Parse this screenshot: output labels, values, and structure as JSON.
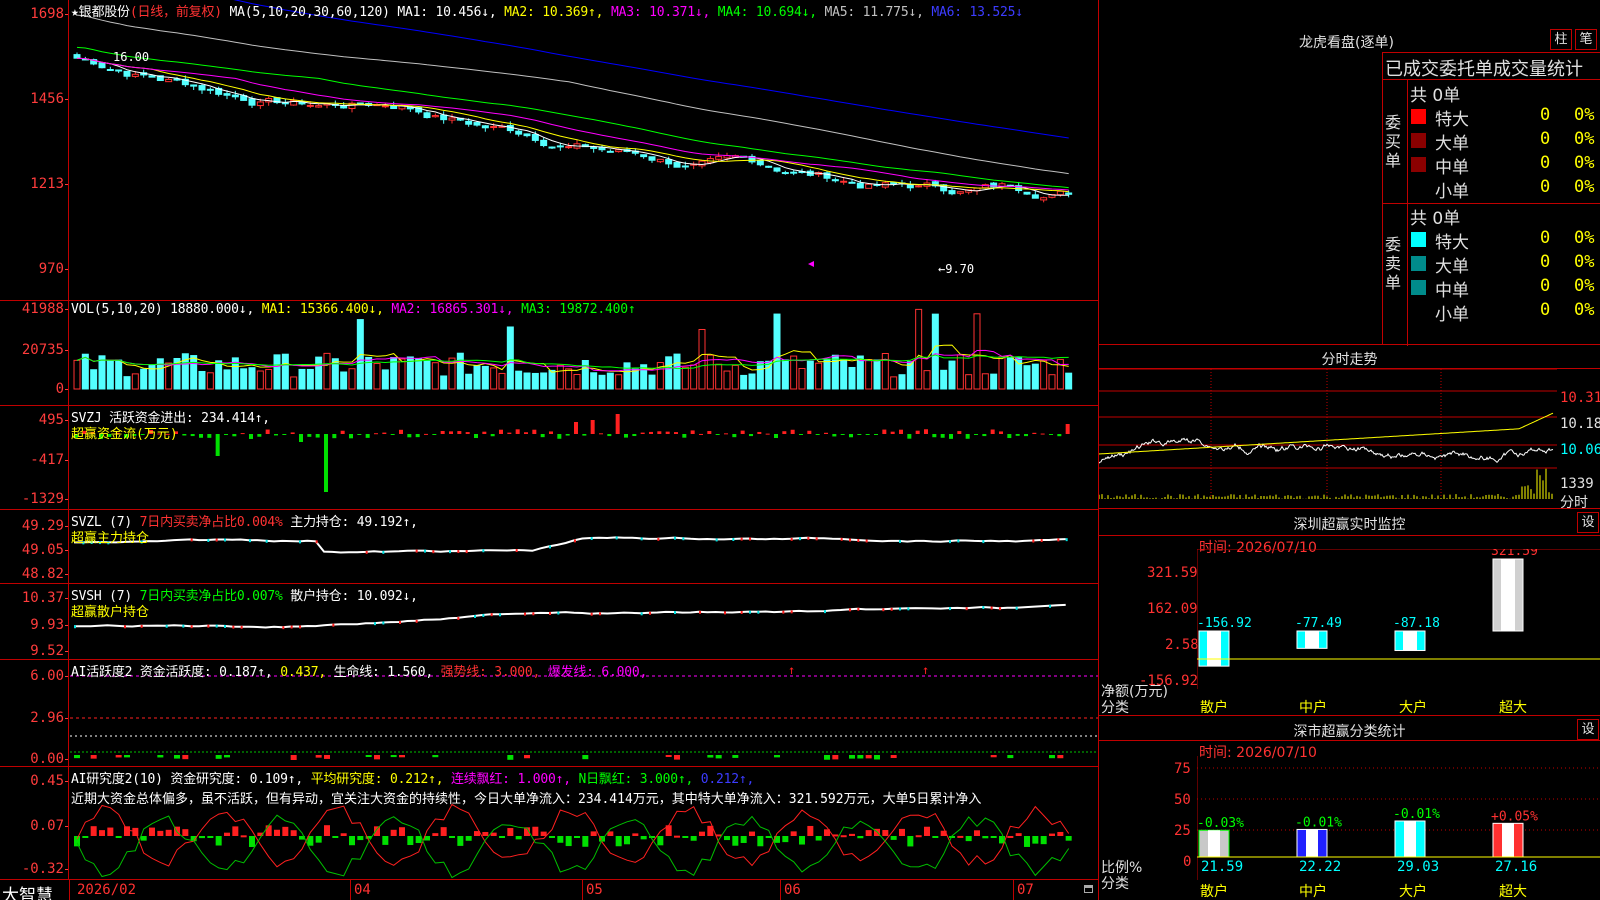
{
  "kline": {
    "star": "★",
    "stock_name": "银都股份",
    "period": "(日线，前复权)",
    "ma_params": "MA(5,10,20,30,60,120)",
    "ma1": "MA1: 10.456↓,",
    "ma2": "MA2: 10.369↑,",
    "ma3": "MA3: 10.371↓,",
    "ma4": "MA4: 10.694↓,",
    "ma5": "MA5: 11.775↓,",
    "ma6": "MA6: 13.525↓",
    "y_ticks": [
      "1698",
      "1456",
      "1213",
      "970"
    ],
    "high_label": "16.00",
    "low_label": "←9.70",
    "colors": {
      "ma1": "#ffffff",
      "ma2": "#ffff00",
      "ma3": "#ff00ff",
      "ma4": "#00ff00",
      "ma5": "#c0c0c0",
      "ma6": "#0000ff",
      "up": "#ff3232",
      "down": "#54ffff"
    }
  },
  "vol": {
    "title": "VOL(5,10,20)",
    "value": "18880.000↓,",
    "ma1": "MA1: 15366.400↓,",
    "ma2": "MA2: 16865.301↓,",
    "ma3": "MA3: 19872.400↑",
    "y_ticks": [
      "41988",
      "20735",
      "0"
    ]
  },
  "svzj": {
    "title": "SVZJ  活跃资金进出: 234.414↑,",
    "subtitle": "超赢资金流(万元)",
    "y_ticks": [
      "495",
      "-417",
      "-1329"
    ]
  },
  "svzl": {
    "title": "SVZL (7)",
    "net": "7日内买卖净占比0.004%",
    "hold": "主力持仓: 49.192↑,",
    "subtitle": "超赢主力持仓",
    "y_ticks": [
      "49.29",
      "49.05",
      "48.82"
    ]
  },
  "svsh": {
    "title": "SVSH (7)",
    "net": "7日内买卖净占比0.007%",
    "hold": "散户持仓: 10.092↓,",
    "subtitle": "超赢散户持仓",
    "y_ticks": [
      "10.37",
      "9.93",
      "9.52"
    ]
  },
  "ai_active": {
    "title": "AI活跃度2 资金活跃度: 0.187↑,",
    "v2": "0.437,",
    "life": "生命线: 1.560,",
    "strong": "强势线: 3.000,",
    "burst": "爆发线: 6.000,",
    "y_ticks": [
      "6.00",
      "2.96",
      "0.00"
    ]
  },
  "ai_research": {
    "title": "AI研究度2(10) 资金研究度: 0.109↑,",
    "avg": "平均研究度: 0.212↑,",
    "cont": "连续飘红: 1.000↑,",
    "nday": "N日飘红: 3.000↑,",
    "last": "0.212↑,",
    "comment": "近期大资金总体偏多，虽不活跃，但有异动，宜关注大资金的持续性，今日大单净流入：234.414万元，其中特大单净流入：321.592万元，大单5日累计净入",
    "y_ticks": [
      "0.45",
      "0.07",
      "-0.32"
    ]
  },
  "xaxis": {
    "brand": "大智慧",
    "labels": [
      "2026/02",
      "04",
      "05",
      "06",
      "07"
    ]
  },
  "lhb": {
    "title": "龙虎看盘(逐单)",
    "btn_bar": "柱",
    "btn_pen": "笔",
    "table_title": "已成交委托单成交量统计",
    "buy_side": "委买单",
    "sell_side": "委卖单",
    "buy_total": "共 0单",
    "sell_total": "共 0单",
    "rows": [
      {
        "label": "特大",
        "count": "0",
        "pct": "0%"
      },
      {
        "label": "大单",
        "count": "0",
        "pct": "0%"
      },
      {
        "label": "中单",
        "count": "0",
        "pct": "0%"
      },
      {
        "label": "小单",
        "count": "0",
        "pct": "0%"
      }
    ],
    "buy_colors": [
      "#ff0000",
      "#8b0000",
      "#8b0000",
      "#000000"
    ],
    "sell_colors": [
      "#00ffff",
      "#008b8b",
      "#008b8b",
      "#000000"
    ]
  },
  "fenshi": {
    "title": "分时走势",
    "y_ticks": [
      "10.31",
      "10.18",
      "10.06"
    ],
    "vol_label": "1339",
    "unit": "分时"
  },
  "sz_monitor": {
    "title": "深圳超赢实时监控",
    "btn": "设",
    "time": "时间: 2026/07/10",
    "y_ticks": [
      "321.59",
      "162.09",
      "2.58",
      "-156.92"
    ],
    "axis_label1": "净额(万元)",
    "axis_label2": "分类",
    "bars": [
      {
        "cat": "散户",
        "value": "-156.92",
        "num": -156.92
      },
      {
        "cat": "中户",
        "value": "-77.49",
        "num": -77.49
      },
      {
        "cat": "大户",
        "value": "-87.18",
        "num": -87.18
      },
      {
        "cat": "超大",
        "value": "321.59",
        "num": 321.59
      }
    ]
  },
  "sz_class": {
    "title": "深市超赢分类统计",
    "btn": "设",
    "time": "时间: 2026/07/10",
    "y_ticks": [
      "75",
      "50",
      "25",
      "0"
    ],
    "axis_label1": "比例%",
    "axis_label2": "分类",
    "bars": [
      {
        "cat": "散户",
        "pct": "21.59",
        "chg": "-0.03%",
        "num": 21.59
      },
      {
        "cat": "中户",
        "pct": "22.22",
        "chg": "-0.01%",
        "num": 22.22
      },
      {
        "cat": "大户",
        "pct": "29.03",
        "chg": "-0.01%",
        "num": 29.03
      },
      {
        "cat": "超大",
        "pct": "27.16",
        "chg": "+0.05%",
        "num": 27.16
      }
    ]
  }
}
